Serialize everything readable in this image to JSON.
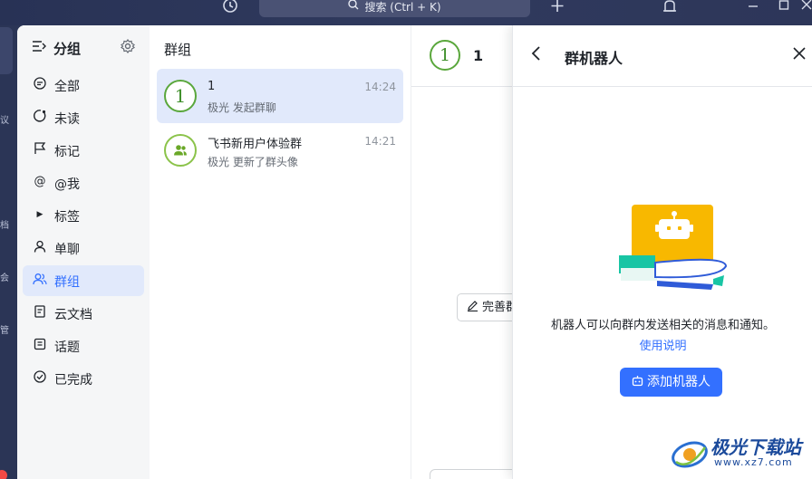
{
  "titlebar": {
    "search_label": "搜索 (Ctrl + K)",
    "icons": [
      "history-icon",
      "search-icon",
      "plus-icon",
      "alarm-icon",
      "minimize-icon",
      "maximize-icon",
      "close-icon"
    ]
  },
  "rail": {
    "clipped_labels": [
      "议",
      "档",
      "会",
      "管"
    ]
  },
  "categories": {
    "title": "分组",
    "items": [
      {
        "label": "全部",
        "icon": "chat-bubble-icon"
      },
      {
        "label": "未读",
        "icon": "unread-icon"
      },
      {
        "label": "标记",
        "icon": "flag-icon"
      },
      {
        "label": "@我",
        "icon": "at-icon"
      },
      {
        "label": "标签",
        "icon": "caret-right-icon"
      },
      {
        "label": "单聊",
        "icon": "person-icon"
      },
      {
        "label": "群组",
        "icon": "group-icon",
        "active": true
      },
      {
        "label": "云文档",
        "icon": "doc-icon"
      },
      {
        "label": "话题",
        "icon": "topic-icon"
      },
      {
        "label": "已完成",
        "icon": "check-circle-icon"
      }
    ]
  },
  "list": {
    "title": "群组",
    "items": [
      {
        "avatar": "1",
        "name": "1",
        "time": "14:24",
        "preview": "极光 发起群聊",
        "selected": true
      },
      {
        "avatar": "group-icon",
        "name": "飞书新用户体验群",
        "time": "14:21",
        "preview": "极光 更新了群头像",
        "selected": false
      }
    ]
  },
  "chat": {
    "avatar": "1",
    "name": "1",
    "complete_button": "完善群"
  },
  "drawer": {
    "title": "群机器人",
    "description": "机器人可以向群内发送相关的消息和通知。",
    "usage_link": "使用说明",
    "add_button": "添加机器人"
  },
  "watermark": {
    "main": "极光下载站",
    "sub": "www.xz7.com"
  },
  "colors": {
    "accent": "#3370ff",
    "active_bg": "#e1e9fb",
    "rail_bg": "#2b3556",
    "avatar_green": "#5aa73c"
  }
}
